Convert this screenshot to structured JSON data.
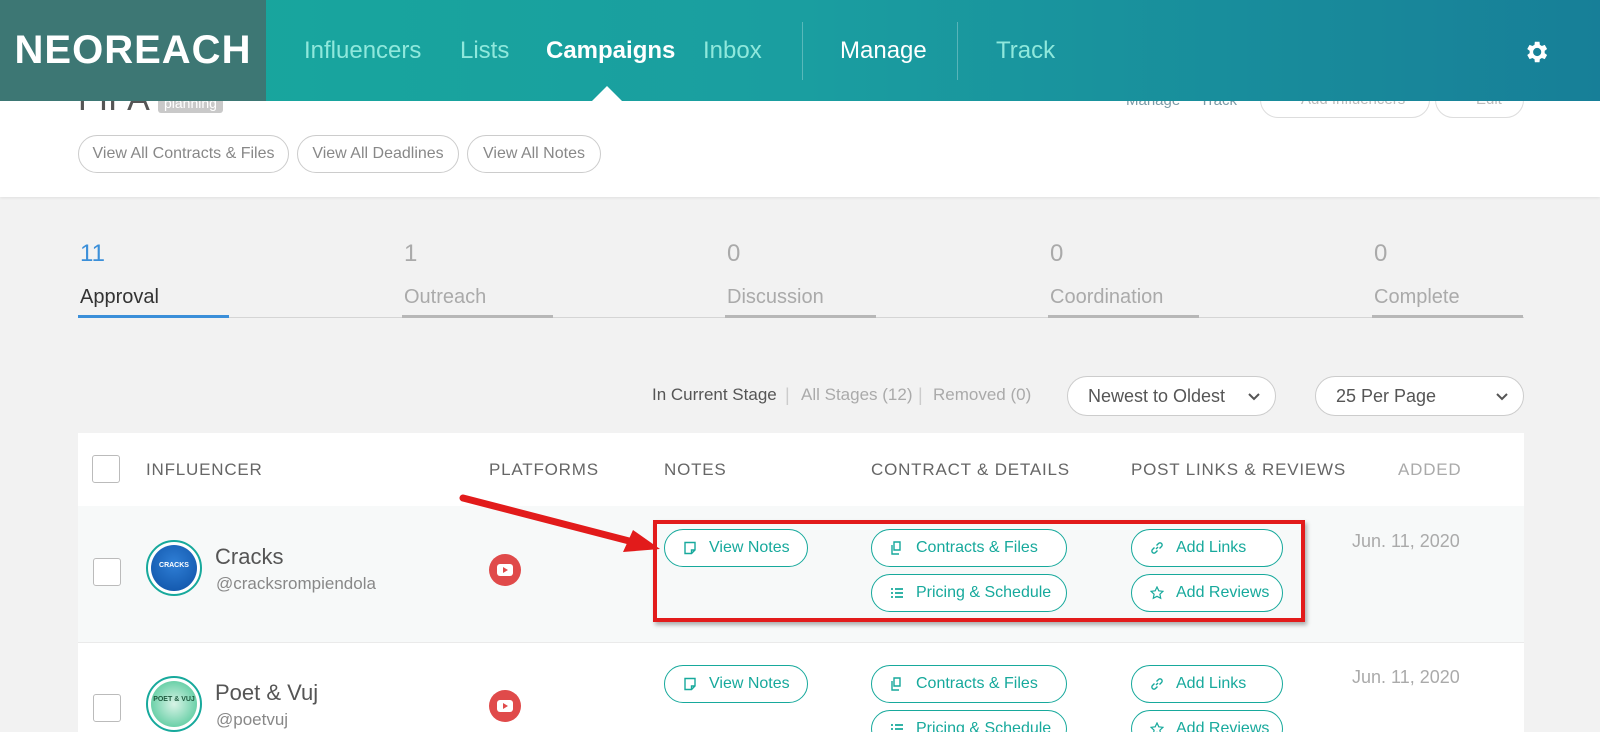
{
  "nav": {
    "logo": "NEOREACH",
    "items": [
      "Influencers",
      "Lists",
      "Campaigns",
      "Inbox",
      "Manage",
      "Track"
    ],
    "active": "Campaigns"
  },
  "header": {
    "title": "FIFA",
    "badge": "planning",
    "ghost_links": [
      "Manage",
      "Track"
    ],
    "ghost_buttons": [
      "Add Influencers",
      "Edit"
    ],
    "pills": [
      "View All Contracts & Files",
      "View All Deadlines",
      "View All Notes"
    ]
  },
  "stages": [
    {
      "count": "11",
      "label": "Approval"
    },
    {
      "count": "1",
      "label": "Outreach"
    },
    {
      "count": "0",
      "label": "Discussion"
    },
    {
      "count": "0",
      "label": "Coordination"
    },
    {
      "count": "0",
      "label": "Complete"
    }
  ],
  "filters": {
    "in_current": "In Current Stage",
    "all_stages": "All Stages (12)",
    "removed": "Removed (0)",
    "sort": "Newest to Oldest",
    "per_page": "25 Per Page"
  },
  "table": {
    "headers": [
      "INFLUENCER",
      "PLATFORMS",
      "NOTES",
      "CONTRACT & DETAILS",
      "POST LINKS & REVIEWS",
      "ADDED"
    ],
    "rows": [
      {
        "name": "Cracks",
        "handle": "@cracksrompiendola",
        "avatar_text": "CRACKS",
        "added": "Jun. 11, 2020"
      },
      {
        "name": "Poet & Vuj",
        "handle": "@poetvuj",
        "avatar_text": "POET & VUJ",
        "added": "Jun. 11, 2020"
      }
    ],
    "actions": {
      "view_notes": "View Notes",
      "contracts": "Contracts & Files",
      "pricing": "Pricing & Schedule",
      "add_links": "Add Links",
      "add_reviews": "Add Reviews"
    }
  },
  "colors": {
    "accent": "#17a99c",
    "active_stage": "#3b8fd9",
    "highlight": "#e21b1b"
  }
}
